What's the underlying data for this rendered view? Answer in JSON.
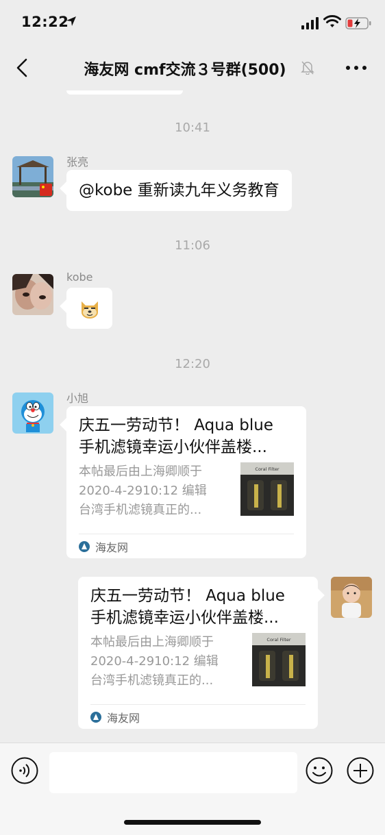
{
  "status_bar": {
    "time": "12:22"
  },
  "nav": {
    "title": "海友网 cmf交流３号群(500)"
  },
  "messages": {
    "ts1": "10:41",
    "m1": {
      "sender": "张亮",
      "text": "@kobe 重新读九年义务教育"
    },
    "ts2": "11:06",
    "m2": {
      "sender": "kobe",
      "sticker": "doge-emoji"
    },
    "ts3": "12:20",
    "m3": {
      "sender": "小旭",
      "title_line1": "庆五一劳动节！ Aqua blue",
      "title_line2": "手机滤镜幸运小伙伴盖楼...",
      "desc_line1": "本帖最后由上海卿顺于",
      "desc_line2": "2020-4-2910:12 编辑",
      "desc_line3": "台湾手机滤镜真正的...",
      "thumb_label": "Coral Filter",
      "source": "海友网"
    },
    "m4": {
      "title_line1": "庆五一劳动节！ Aqua blue",
      "title_line2": "手机滤镜幸运小伙伴盖楼...",
      "desc_line1": "本帖最后由上海卿顺于",
      "desc_line2": "2020-4-2910:12 编辑",
      "desc_line3": "台湾手机滤镜真正的...",
      "thumb_label": "Coral Filter",
      "source": "海友网"
    }
  },
  "input_bar": {
    "placeholder": ""
  },
  "icons": {
    "back": "chevron-left-icon",
    "mute": "bell-slash-icon",
    "more": "more-dots-icon",
    "voice": "voice-icon",
    "emoji": "emoji-icon",
    "plus": "plus-icon"
  },
  "colors": {
    "background": "#ededed",
    "bubble": "#ffffff",
    "timestamp": "#a9a9a9"
  }
}
